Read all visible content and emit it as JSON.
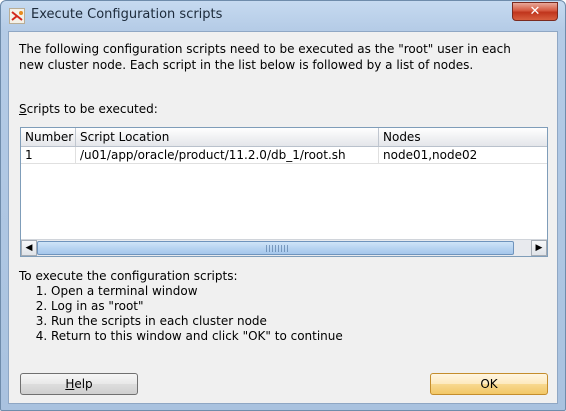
{
  "window": {
    "title": "Execute Configuration scripts",
    "close_glyph": "✕"
  },
  "description": "The following configuration scripts need to be executed as the \"root\" user in each new cluster node. Each script in the list below is followed by a list of nodes.",
  "scripts_label": {
    "accelerator": "S",
    "rest": "cripts to be executed:"
  },
  "table": {
    "columns": [
      "Number",
      "Script Location",
      "Nodes"
    ],
    "rows": [
      [
        "1",
        "/u01/app/oracle/product/11.2.0/db_1/root.sh",
        "node01,node02"
      ]
    ]
  },
  "scrollbar": {
    "left_arrow": "◀",
    "right_arrow": "▶"
  },
  "instructions": {
    "heading": "To execute the configuration scripts:",
    "steps": [
      "Open a terminal window",
      "Log in as \"root\"",
      "Run the scripts in each cluster node",
      "Return to this window and click \"OK\" to continue"
    ]
  },
  "buttons": {
    "help_accelerator": "H",
    "help_rest": "elp",
    "ok": "OK"
  },
  "icons": {
    "app": "oracle-installer-icon",
    "close": "close-icon"
  },
  "colors": {
    "titlebar": "#b4cbe6",
    "client_bg": "#f0f0f0",
    "ok_button": "#f8d88f",
    "close_button": "#c0351c",
    "scroll_thumb": "#b8d4f1"
  }
}
